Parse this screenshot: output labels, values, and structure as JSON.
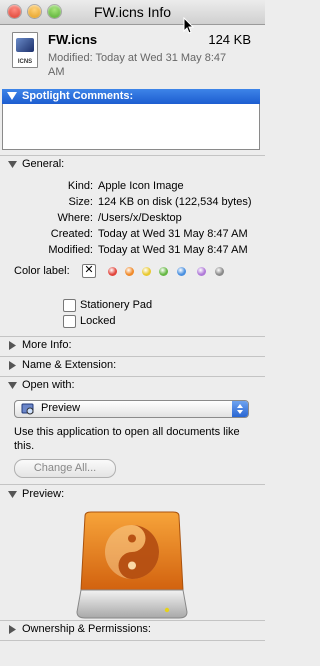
{
  "window": {
    "title": "FW.icns Info"
  },
  "header": {
    "icon_label": "ICNS",
    "filename": "FW.icns",
    "size": "124 KB",
    "modified": "Modified: Today at Wed 31 May 8:47 AM"
  },
  "spotlight": {
    "label": "Spotlight Comments:",
    "text": ""
  },
  "general": {
    "label": "General:",
    "rows": [
      {
        "key": "Kind:",
        "value": "Apple Icon Image"
      },
      {
        "key": "Size:",
        "value": "124 KB on disk (122,534 bytes)"
      },
      {
        "key": "Where:",
        "value": "/Users/x/Desktop"
      },
      {
        "key": "Created:",
        "value": "Today at Wed 31 May 8:47 AM"
      },
      {
        "key": "Modified:",
        "value": "Today at Wed 31 May 8:47 AM"
      }
    ],
    "color_label": "Color label:",
    "label_colors": [
      "#e2453c",
      "#f08a2a",
      "#e9c930",
      "#66b844",
      "#4a90e0",
      "#b07ad8",
      "#8a8a8a"
    ],
    "stationery_label": "Stationery Pad",
    "locked_label": "Locked"
  },
  "more_info": {
    "label": "More Info:"
  },
  "name_ext": {
    "label": "Name & Extension:"
  },
  "open_with": {
    "label": "Open with:",
    "app": "Preview",
    "description": "Use this application to open all documents like this.",
    "change_all": "Change All..."
  },
  "preview": {
    "label": "Preview:"
  },
  "ownership": {
    "label": "Ownership & Permissions:"
  }
}
